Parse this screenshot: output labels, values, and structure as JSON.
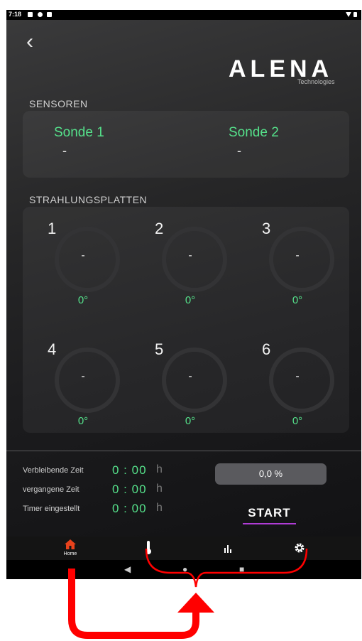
{
  "status_bar": {
    "time": "7:18"
  },
  "brand": {
    "name": "ALENA",
    "subtitle": "Technologies"
  },
  "sensors": {
    "title": "SENSOREN",
    "items": [
      {
        "label": "Sonde 1",
        "value": "-"
      },
      {
        "label": "Sonde 2",
        "value": "-"
      }
    ]
  },
  "plates": {
    "title": "STRAHLUNGSPLATTEN",
    "items": [
      {
        "number": "1",
        "value": "-",
        "angle": "0°"
      },
      {
        "number": "2",
        "value": "-",
        "angle": "0°"
      },
      {
        "number": "3",
        "value": "-",
        "angle": "0°"
      },
      {
        "number": "4",
        "value": "-",
        "angle": "0°"
      },
      {
        "number": "5",
        "value": "-",
        "angle": "0°"
      },
      {
        "number": "6",
        "value": "-",
        "angle": "0°"
      }
    ]
  },
  "timers": [
    {
      "label": "Verbleibende Zeit",
      "value": "0 : 00",
      "unit": "h"
    },
    {
      "label": "vergangene Zeit",
      "value": "0 : 00",
      "unit": "h"
    },
    {
      "label": "Timer eingestellt",
      "value": "0 : 00",
      "unit": "h"
    }
  ],
  "progress": {
    "text": "0,0 %",
    "fraction": 0.0
  },
  "start_label": "START",
  "bottom_nav": {
    "items": [
      {
        "label": "Home",
        "icon": "home-icon",
        "active": true,
        "color": "#e8421c"
      },
      {
        "label": "",
        "icon": "thermometer-icon"
      },
      {
        "label": "",
        "icon": "bar-chart-icon"
      },
      {
        "label": "",
        "icon": "gear-icon"
      }
    ]
  },
  "colors": {
    "accent_green": "#55e08a",
    "annotation_red": "#ff0000",
    "start_underline": "#b03cd6"
  }
}
